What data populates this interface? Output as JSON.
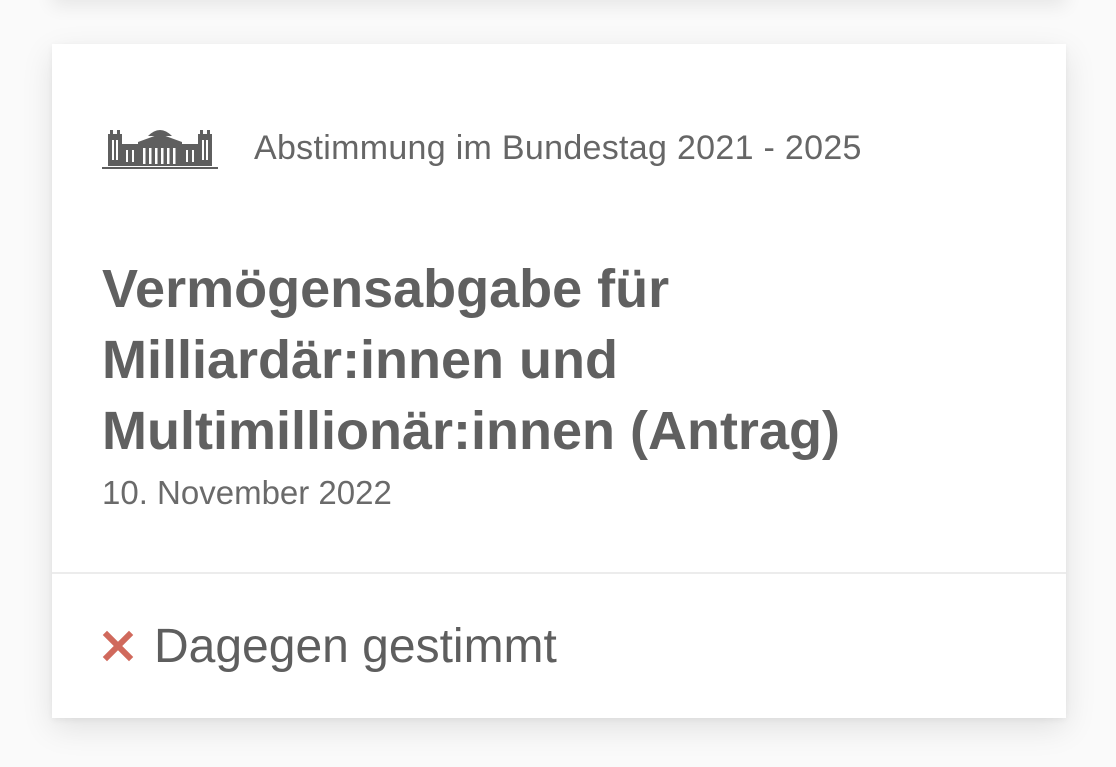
{
  "header": {
    "icon": "bundestag-building-icon",
    "text": "Abstimmung im Bundestag 2021 - 2025"
  },
  "vote": {
    "title": "Vermögensabgabe für Milliardär:innen und Multimillionär:innen (Antrag)",
    "date": "10. November 2022"
  },
  "result": {
    "icon": "x-icon",
    "icon_color": "#d0695c",
    "label": "Dagegen gestimmt"
  },
  "colors": {
    "text_primary": "#606060",
    "text_secondary": "#666666",
    "background": "#fafafa",
    "card": "#ffffff"
  }
}
